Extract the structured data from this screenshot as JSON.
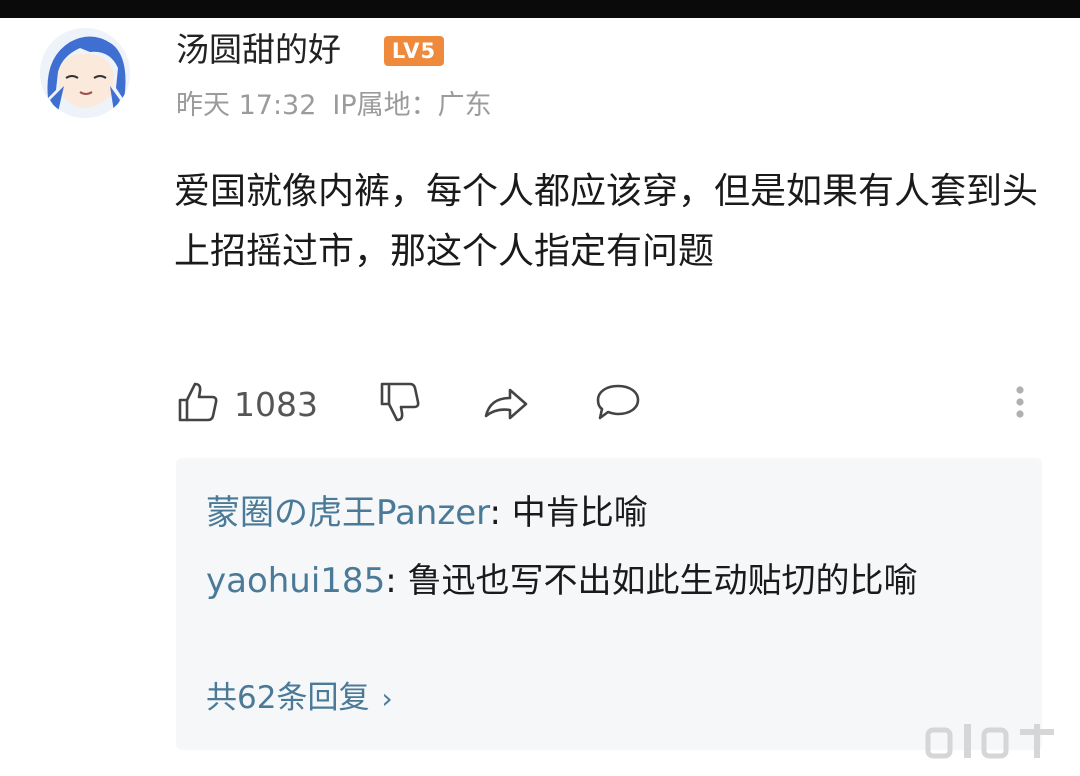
{
  "comment": {
    "username": "汤圆甜的好",
    "level_badge": "LV5",
    "time": "昨天 17:32",
    "ip_location": "IP属地：广东",
    "text": "爱国就像内裤，每个人都应该穿，但是如果有人套到头上招摇过市，那这个人指定有问题",
    "like_count": "1083"
  },
  "replies": [
    {
      "author": "蒙圈の虎王Panzer",
      "separator": ": ",
      "text": "中肯比喻"
    },
    {
      "author": "yaohui185",
      "separator": ": ",
      "text": "鲁迅也写不出如此生动贴切的比喻"
    }
  ],
  "more_replies": "共62条回复",
  "icons": {
    "like": "thumbs-up-icon",
    "dislike": "thumbs-down-icon",
    "share": "share-icon",
    "reply": "comment-bubble-icon",
    "more": "more-vertical-icon"
  },
  "colors": {
    "author_link": "#4a7a97",
    "meta_text": "#9b9b9b",
    "level_badge": "#ef8a3c",
    "reply_background": "#f5f7f9"
  }
}
